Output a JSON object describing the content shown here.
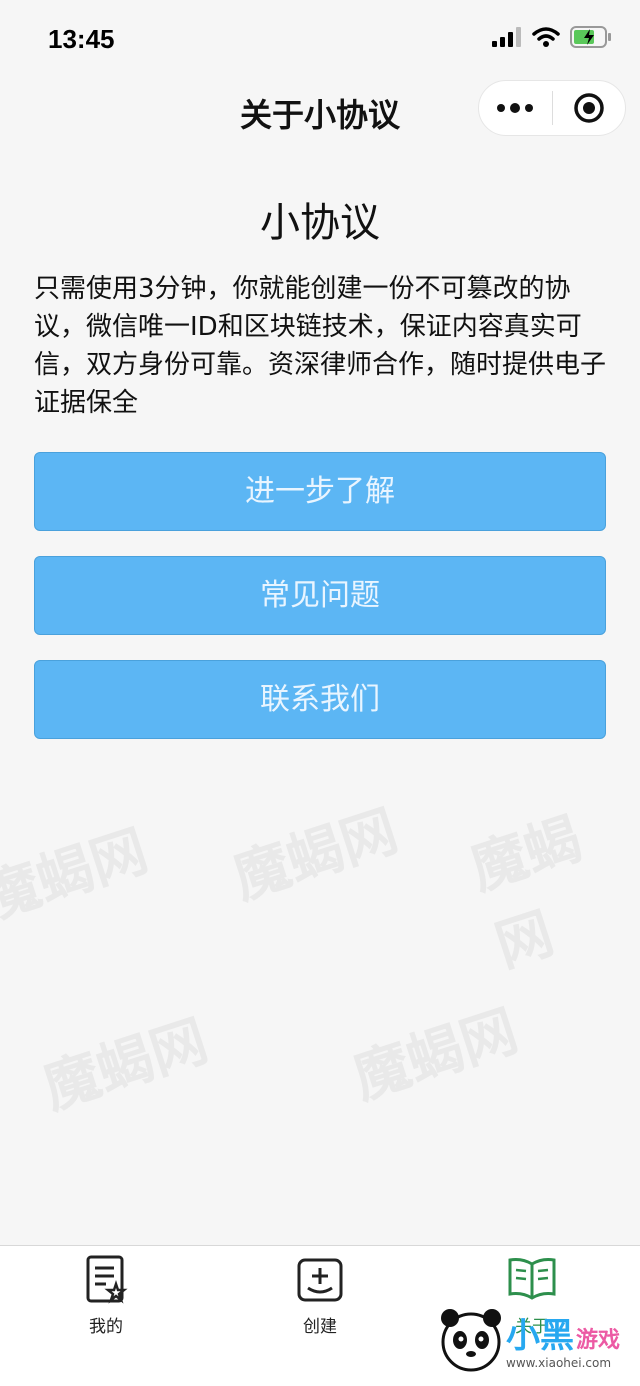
{
  "status_bar": {
    "time": "13:45"
  },
  "nav": {
    "title": "关于小协议",
    "more_icon": "ellipsis-icon",
    "close_icon": "target-icon"
  },
  "main": {
    "app_name": "小协议",
    "description": "只需使用3分钟，你就能创建一份不可篡改的协议，微信唯一ID和区块链技术，保证内容真实可信，双方身份可靠。资深律师合作，随时提供电子证据保全",
    "buttons": [
      {
        "label": "进一步了解"
      },
      {
        "label": "常见问题"
      },
      {
        "label": "联系我们"
      }
    ],
    "button_color": "#5cb6f4"
  },
  "watermark": {
    "text": "魔蝎网"
  },
  "tab_bar": {
    "tabs": [
      {
        "label": "我的",
        "icon": "document-star-icon",
        "active": false
      },
      {
        "label": "创建",
        "icon": "add-square-icon",
        "active": false
      },
      {
        "label": "关于",
        "icon": "open-book-icon",
        "active": true
      }
    ],
    "active_color": "#2d8f4c"
  },
  "corner_logo": {
    "text": "小黑",
    "sub": "游戏",
    "url": "www.xiaohei.com"
  }
}
